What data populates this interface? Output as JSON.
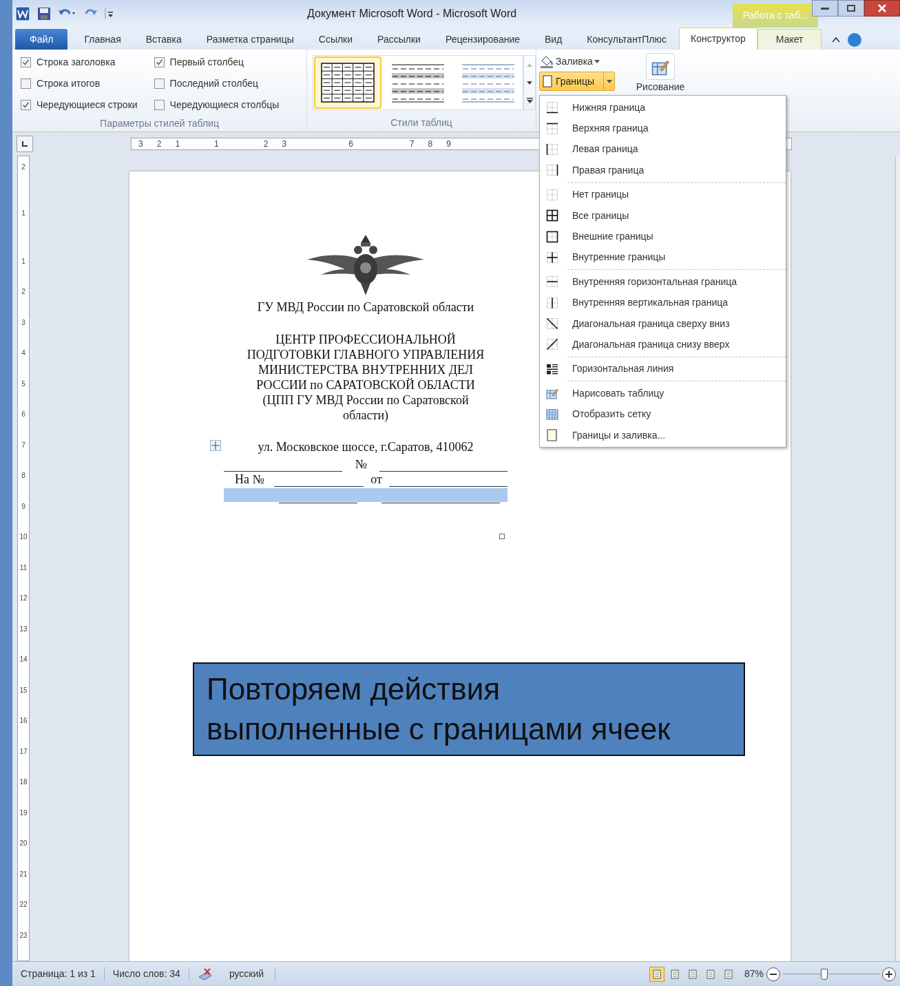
{
  "title_bar": {
    "title": "Документ Microsoft Word  -  Microsoft Word",
    "context_tab": "Работа с таб..."
  },
  "tabs": [
    {
      "label": "Файл",
      "kind": "file",
      "selected": false
    },
    {
      "label": "Главная",
      "kind": "tab",
      "selected": false
    },
    {
      "label": "Вставка",
      "kind": "tab",
      "selected": false
    },
    {
      "label": "Разметка страницы",
      "kind": "tab",
      "selected": false
    },
    {
      "label": "Ссылки",
      "kind": "tab",
      "selected": false
    },
    {
      "label": "Рассылки",
      "kind": "tab",
      "selected": false
    },
    {
      "label": "Рецензирование",
      "kind": "tab",
      "selected": false
    },
    {
      "label": "Вид",
      "kind": "tab",
      "selected": false
    },
    {
      "label": "КонсультантПлюс",
      "kind": "tab",
      "selected": false
    },
    {
      "label": "Конструктор",
      "kind": "context",
      "selected": true
    },
    {
      "label": "Макет",
      "kind": "context",
      "selected": false
    }
  ],
  "style_options": {
    "checkboxes": [
      {
        "label": "Строка заголовка",
        "checked": true
      },
      {
        "label": "Строка итогов",
        "checked": false
      },
      {
        "label": "Чередующиеся строки",
        "checked": true
      },
      {
        "label": "Первый столбец",
        "checked": true
      },
      {
        "label": "Последний столбец",
        "checked": false
      },
      {
        "label": "Чередующиеся столбцы",
        "checked": false
      }
    ],
    "group_label": "Параметры стилей таблиц"
  },
  "table_styles": {
    "thumbnails": [
      {
        "kind": "grid",
        "selected": true
      },
      {
        "kind": "gray",
        "selected": false
      },
      {
        "kind": "blue",
        "selected": false
      }
    ],
    "group_label": "Стили таблиц"
  },
  "shading_button": "Заливка",
  "borders_button": "Границы",
  "draw_group_label": "Рисование",
  "borders_menu": [
    {
      "items": [
        {
          "label": "Нижняя граница",
          "kind": "bottom"
        },
        {
          "label": "Верхняя граница",
          "kind": "top"
        },
        {
          "label": "Левая граница",
          "kind": "left"
        },
        {
          "label": "Правая граница",
          "kind": "right"
        }
      ]
    },
    {
      "items": [
        {
          "label": "Нет границы",
          "kind": "none"
        },
        {
          "label": "Все границы",
          "kind": "all"
        },
        {
          "label": "Внешние границы",
          "kind": "outside"
        },
        {
          "label": "Внутренние границы",
          "kind": "inside"
        }
      ]
    },
    {
      "items": [
        {
          "label": "Внутренняя горизонтальная граница",
          "kind": "inside_h"
        },
        {
          "label": "Внутренняя вертикальная граница",
          "kind": "inside_v"
        },
        {
          "label": "Диагональная граница сверху вниз",
          "kind": "diag_down"
        },
        {
          "label": "Диагональная граница снизу вверх",
          "kind": "diag_up"
        }
      ]
    },
    {
      "items": [
        {
          "label": "Горизонтальная линия",
          "kind": "hline"
        }
      ]
    },
    {
      "items": [
        {
          "label": "Нарисовать таблицу",
          "kind": "draw"
        },
        {
          "label": "Отобразить сетку",
          "kind": "grid"
        },
        {
          "label": "Границы и заливка...",
          "kind": "page"
        }
      ]
    }
  ],
  "horizontal_ruler": [
    "3",
    "2",
    "1",
    "1",
    "2",
    "3",
    "6",
    "7",
    "8",
    "9"
  ],
  "vertical_ruler": [
    "2",
    "1",
    "1",
    "2",
    "3",
    "4",
    "5",
    "6",
    "7",
    "8",
    "9",
    "10",
    "11",
    "12",
    "13",
    "14",
    "15",
    "16",
    "17",
    "18",
    "19",
    "20",
    "21",
    "22",
    "23"
  ],
  "document": {
    "org": "ГУ МВД России по Саратовской области",
    "center_lines": [
      "ЦЕНТР ПРОФЕССИОНАЛЬНОЙ",
      "ПОДГОТОВКИ ГЛАВНОГО УПРАВЛЕНИЯ",
      "МИНИСТЕРСТВА  ВНУТРЕННИХ ДЕЛ",
      "РОССИИ по САРАТОВСКОЙ ОБЛАСТИ",
      "(ЦПП ГУ МВД России по Саратовской",
      "области)"
    ],
    "address": "ул. Московское шоссе, г.Саратов, 410062",
    "number_label": "№",
    "ref_label": "На №",
    "date_label": "от"
  },
  "overlay_box": {
    "lines": [
      "Повторяем действия",
      "выполненные с границами ячеек"
    ]
  },
  "status_bar": {
    "page": "Страница: 1 из 1",
    "words": "Число слов: 34",
    "language": "русский",
    "views": [
      {
        "selected": true
      },
      {
        "selected": false
      },
      {
        "selected": false
      },
      {
        "selected": false
      },
      {
        "selected": false
      }
    ],
    "zoom": "87%",
    "level": 0.43
  }
}
